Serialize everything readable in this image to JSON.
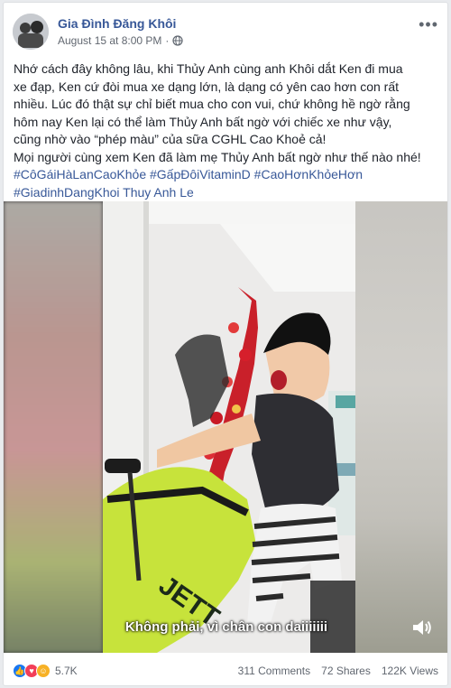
{
  "post": {
    "page_name": "Gia Đình Đăng Khôi",
    "timestamp": "August 15 at 8:00 PM",
    "separator": "·",
    "audience_icon": "globe-icon",
    "more_icon": "more-options-icon",
    "text_lines": [
      "Nhớ cách đây không lâu, khi Thủy Anh cùng anh Khôi dắt Ken đi mua",
      "xe đạp, Ken cứ đòi mua xe dạng lớn, là dạng có yên cao hơn con rất",
      "nhiều. Lúc đó thật sự chỉ biết mua cho con vui, chứ không hề ngờ rằng",
      "hôm nay Ken lại có thể làm Thủy Anh bất ngờ với chiếc xe như vậy,",
      "cũng nhờ vào “phép màu” của sữa CGHL Cao Khoẻ cả!",
      "Mọi người cùng xem Ken đã làm mẹ Thủy Anh bất ngờ như thế nào nhé!"
    ],
    "hashtags_line1": "#CôGáiHàLanCaoKhỏe #GấpĐôiVitaminD #CaoHơnKhỏeHơn",
    "hashtags_line2": "#GiadinhDangKhoi Thuy Anh Le"
  },
  "video": {
    "subtitle": "Không phải, vì chân con daiiiiiii",
    "volume_icon": "volume-icon"
  },
  "footer": {
    "reaction_count": "5.7K",
    "comments": "311 Comments",
    "shares": "72 Shares",
    "views": "122K Views",
    "colors": {
      "like": "#1877f2",
      "love": "#f33e58",
      "haha": "#f7b125"
    }
  }
}
